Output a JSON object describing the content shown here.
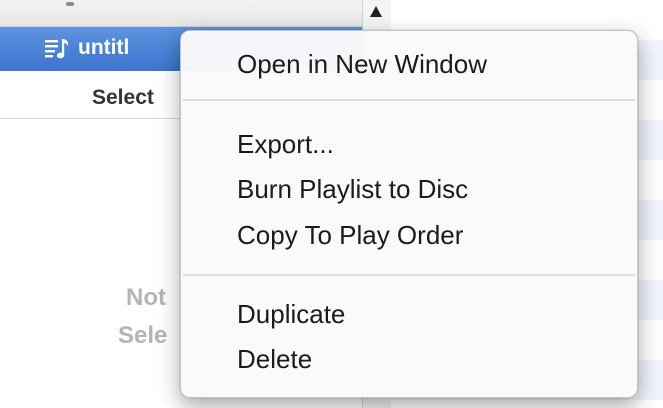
{
  "sidebar": {
    "playlist_row": {
      "icon": "playlist-icon",
      "label": "untitl"
    },
    "select_label": "Select",
    "empty_state": {
      "line1": "Not",
      "line2": "Sele"
    },
    "scroll_up_icon": "scroll-up-arrow-icon"
  },
  "context_menu": {
    "items": [
      {
        "label": "Open in New Window"
      },
      {
        "label": "Export..."
      },
      {
        "label": "Burn Playlist to Disc"
      },
      {
        "label": "Copy To Play Order"
      },
      {
        "label": "Duplicate"
      },
      {
        "label": "Delete"
      }
    ]
  },
  "colors": {
    "selection_blue": "#3c74cf",
    "menu_background": "#fafafa",
    "menu_text": "#1b1b1b",
    "empty_state_text": "#b5b5b5"
  }
}
